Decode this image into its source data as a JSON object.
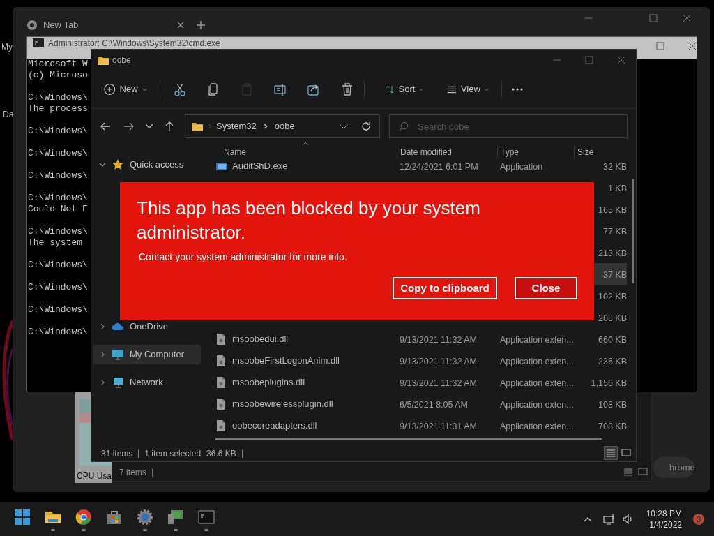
{
  "desktop": {
    "labels": [
      "My",
      "Da"
    ]
  },
  "browser": {
    "tab": {
      "label": "New Tab"
    },
    "shortcut_label": "hrome"
  },
  "task_manager": {
    "label": "CPU Usa"
  },
  "back_explorer": {
    "status": "7 items",
    "view_modes": [
      {
        "kind": "details",
        "selected": false
      },
      {
        "kind": "tiles",
        "selected": false
      }
    ]
  },
  "cmd": {
    "title": "Administrator: C:\\Windows\\System32\\cmd.exe",
    "blocks": [
      [
        "Microsoft W",
        "(c) Microso"
      ],
      [
        "C:\\Windows\\",
        "The process"
      ],
      [
        "C:\\Windows\\"
      ],
      [
        "C:\\Windows\\"
      ],
      [
        "C:\\Windows\\"
      ],
      [
        "C:\\Windows\\",
        "Could Not F"
      ],
      [
        "C:\\Windows\\",
        "The system"
      ],
      [
        "C:\\Windows\\"
      ],
      [
        "C:\\Windows\\"
      ],
      [
        "C:\\Windows\\"
      ],
      [
        "C:\\Windows\\"
      ]
    ]
  },
  "explorer": {
    "title": "oobe",
    "toolbar": [
      {
        "kind": "new",
        "label": "New",
        "disabled": false
      },
      {
        "kind": "cut",
        "disabled": false
      },
      {
        "kind": "copy",
        "disabled": false
      },
      {
        "kind": "paste",
        "disabled": true
      },
      {
        "kind": "rename",
        "disabled": false
      },
      {
        "kind": "share",
        "disabled": false
      },
      {
        "kind": "delete",
        "disabled": false
      },
      {
        "kind": "sort",
        "label": "Sort",
        "disabled": false
      },
      {
        "kind": "view",
        "label": "View",
        "disabled": false
      },
      {
        "kind": "more",
        "disabled": false
      }
    ],
    "address": {
      "crumbs": [
        "System32",
        "oobe"
      ]
    },
    "search": {
      "placeholder": "Search oobe"
    },
    "nav": [
      {
        "label": "Quick access",
        "kind": "star",
        "expanded": true,
        "selected": false
      },
      {
        "label": "OneDrive",
        "kind": "cloud",
        "expanded": false,
        "selected": false
      },
      {
        "label": "My Computer",
        "kind": "computer",
        "expanded": false,
        "selected": true
      },
      {
        "label": "Network",
        "kind": "network",
        "expanded": false,
        "selected": false
      }
    ],
    "columns": [
      "Name",
      "Date modified",
      "Type",
      "Size"
    ],
    "rows": [
      {
        "kind": "exe",
        "name": "AuditShD.exe",
        "date": "12/24/2021 6:01 PM",
        "type": "Application",
        "size": "32 KB",
        "selected": false
      },
      {
        "size": "1 KB",
        "selected": false
      },
      {
        "size": "165 KB",
        "selected": false
      },
      {
        "size": "77 KB",
        "selected": false
      },
      {
        "size": "213 KB",
        "selected": false
      },
      {
        "size": "37 KB",
        "selected": true
      },
      {
        "size": "102 KB",
        "selected": false
      },
      {
        "size": "208 KB",
        "selected": false
      },
      {
        "kind": "dll",
        "name": "msoobedui.dll",
        "date": "9/13/2021 11:32 AM",
        "type": "Application exten...",
        "size": "660 KB",
        "selected": false
      },
      {
        "kind": "dll",
        "name": "msoobeFirstLogonAnim.dll",
        "date": "9/13/2021 11:32 AM",
        "type": "Application exten...",
        "size": "236 KB",
        "selected": false
      },
      {
        "kind": "dll",
        "name": "msoobeplugins.dll",
        "date": "9/13/2021 11:32 AM",
        "type": "Application exten...",
        "size": "1,156 KB",
        "selected": false
      },
      {
        "kind": "dll",
        "name": "msoobewirelessplugin.dll",
        "date": "6/5/2021 8:05 AM",
        "type": "Application exten...",
        "size": "108 KB",
        "selected": false
      },
      {
        "kind": "dll",
        "name": "oobecoreadapters.dll",
        "date": "9/13/2021 11:31 AM",
        "type": "Application exten...",
        "size": "708 KB",
        "selected": false
      }
    ],
    "status": {
      "count": "31 items",
      "selection": "1 item selected",
      "size": "36.6 KB"
    },
    "view_modes": [
      {
        "kind": "details",
        "selected": true
      },
      {
        "kind": "tiles",
        "selected": false
      }
    ]
  },
  "dialog": {
    "title": "This app has been blocked by your system administrator.",
    "message": "Contact your system administrator for more info.",
    "buttons": [
      {
        "label": "Copy to clipboard",
        "primary": false
      },
      {
        "label": "Close",
        "primary": true
      }
    ]
  },
  "taskbar": {
    "apps": [
      {
        "kind": "start",
        "running": false
      },
      {
        "kind": "explorer",
        "running": true
      },
      {
        "kind": "chrome",
        "running": true
      },
      {
        "kind": "store",
        "running": false
      },
      {
        "kind": "settings",
        "running": true
      },
      {
        "kind": "computer",
        "running": true
      },
      {
        "kind": "terminal",
        "running": true
      }
    ],
    "clock": {
      "time": "10:28 PM",
      "date": "1/4/2022"
    },
    "notification_count": "3"
  }
}
